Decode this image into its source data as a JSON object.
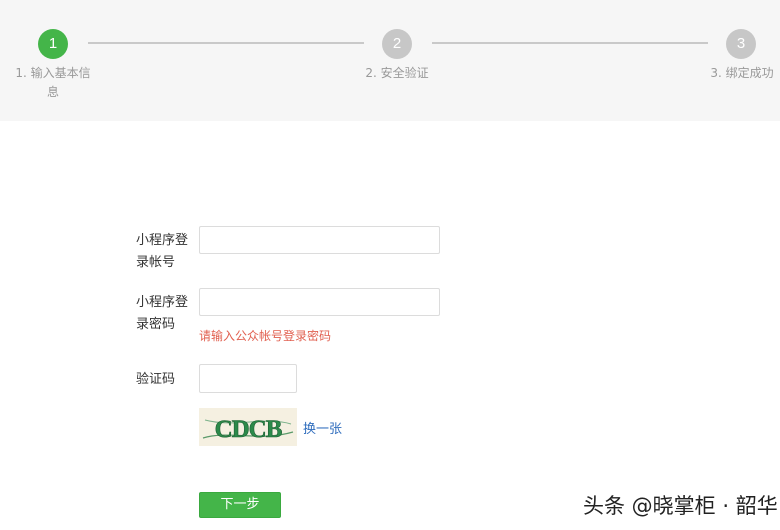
{
  "colors": {
    "active_step": "#44b549",
    "inactive_step": "#c7c7c7",
    "error": "#e15f4f",
    "link": "#2f6dbd",
    "primary_button": "#44b549"
  },
  "steps": [
    {
      "number": "1",
      "label_line1": "1. 输入基本信",
      "label_line2": "息",
      "state": "active"
    },
    {
      "number": "2",
      "label": "2. 安全验证",
      "state": "inactive"
    },
    {
      "number": "3",
      "label": "3. 绑定成功",
      "state": "inactive"
    }
  ],
  "form": {
    "account": {
      "label_line1": "小程序登",
      "label_line2": "录帐号",
      "value": ""
    },
    "password": {
      "label_line1": "小程序登",
      "label_line2": "录密码",
      "value": "",
      "error": "请输入公众帐号登录密码"
    },
    "captcha": {
      "label": "验证码",
      "value": "",
      "image_text": "CDCB",
      "refresh_label": "换一张"
    }
  },
  "next_button": {
    "label": "下一步"
  },
  "watermark": "头条 @晓掌柜 · 韶华"
}
